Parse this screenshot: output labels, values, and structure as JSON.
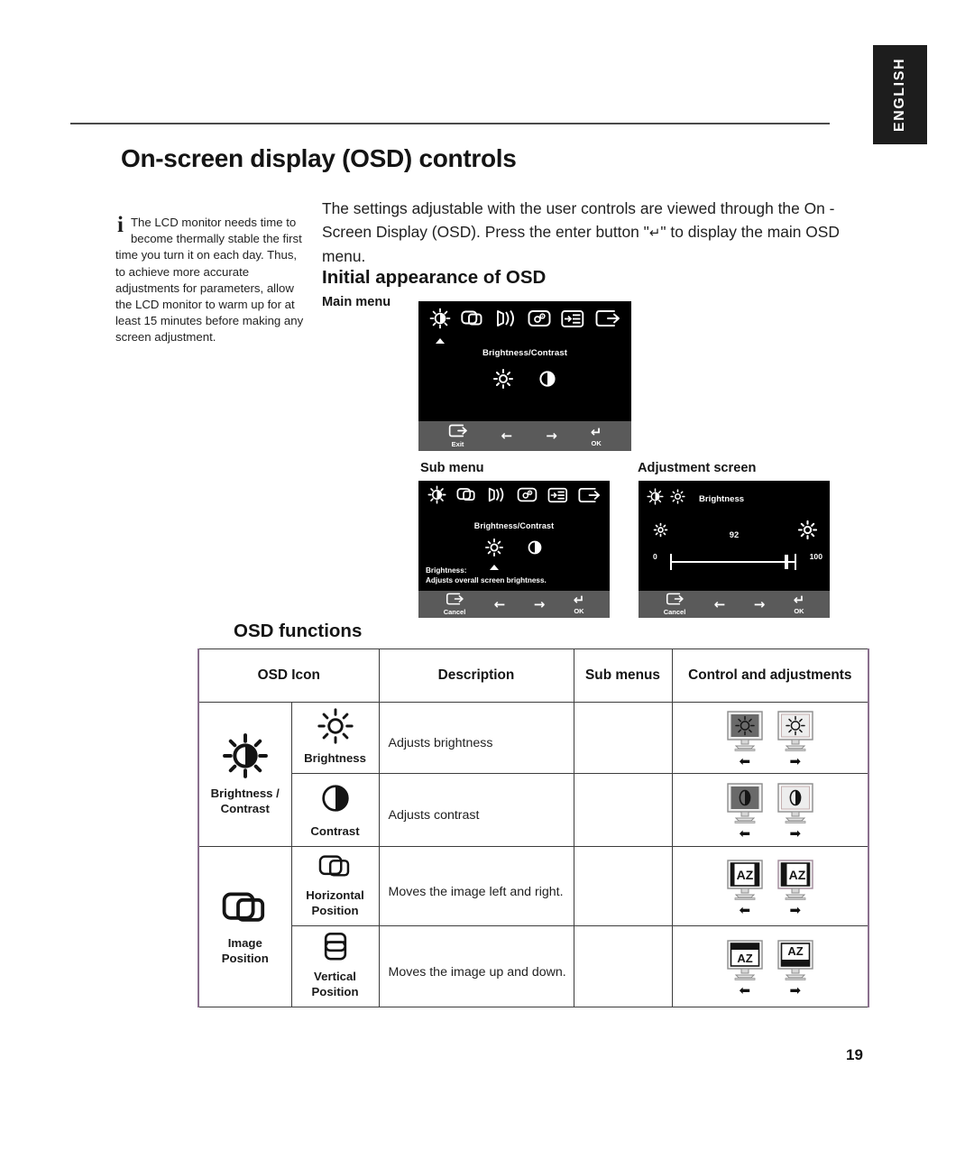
{
  "language_tab": {
    "label": "ENGLISH"
  },
  "page": {
    "number": "19"
  },
  "header": {
    "title": "On-screen display (OSD) controls"
  },
  "note": {
    "marker": "i",
    "text": "The LCD monitor needs time to become thermally stable the first time you turn it on each day. Thus, to achieve more accurate adjustments for parameters, allow the LCD monitor to warm up for  at least 15 minutes before making any screen adjustment."
  },
  "intro": {
    "part1": "The settings adjustable with the user controls are viewed through the On - Screen Display (OSD). Press the enter button \"",
    "enter_symbol": "↵",
    "part2": "\" to display the main OSD menu."
  },
  "sections": {
    "initial_appearance": "Initial appearance of OSD",
    "osd_functions": "OSD functions"
  },
  "osd_panels": {
    "main": {
      "caption": "Main menu",
      "title": "Brightness/Contrast",
      "icons": [
        "brightness-contrast-icon",
        "image-position-icon",
        "image-setup-icon",
        "image-properties-icon",
        "options-icon",
        "exit-icon"
      ],
      "sub_icons": [
        "brightness-sun-icon",
        "contrast-halfmoon-icon"
      ],
      "footer": [
        {
          "icon": "exit-icon",
          "label": "Exit"
        },
        {
          "icon": "left-arrow-icon",
          "label": ""
        },
        {
          "icon": "right-arrow-icon",
          "label": ""
        },
        {
          "icon": "enter-icon",
          "label": "OK"
        }
      ]
    },
    "sub": {
      "caption": "Sub menu",
      "title": "Brightness/Contrast",
      "desc_line1": "Brightness:",
      "desc_line2": "Adjusts overall screen brightness.",
      "footer": [
        {
          "icon": "exit-icon",
          "label": "Cancel"
        },
        {
          "icon": "left-arrow-icon",
          "label": ""
        },
        {
          "icon": "right-arrow-icon",
          "label": ""
        },
        {
          "icon": "enter-icon",
          "label": "OK"
        }
      ]
    },
    "adjustment": {
      "caption": "Adjustment screen",
      "title": "Brightness",
      "value": "92",
      "min": "0",
      "max": "100",
      "footer": [
        {
          "icon": "exit-icon",
          "label": "Cancel"
        },
        {
          "icon": "left-arrow-icon",
          "label": ""
        },
        {
          "icon": "right-arrow-icon",
          "label": ""
        },
        {
          "icon": "enter-icon",
          "label": "OK"
        }
      ]
    }
  },
  "table": {
    "headers": {
      "osd_icon": "OSD Icon",
      "description": "Description",
      "sub_menus": "Sub menus",
      "control": "Control and adjustments"
    },
    "groups": [
      {
        "category_label_line1": "Brightness /",
        "category_label_line2": "Contrast",
        "category_icon": "brightness-contrast-icon",
        "rows": [
          {
            "sub_label_line1": "Brightness",
            "sub_label_line2": "",
            "sub_icon": "brightness-sun-icon",
            "description": "Adjusts brightness",
            "sub_menus": "",
            "control_icon": "monitor-brightness-pair"
          },
          {
            "sub_label_line1": "Contrast",
            "sub_label_line2": "",
            "sub_icon": "contrast-halfmoon-icon",
            "description": "Adjusts contrast",
            "sub_menus": "",
            "control_icon": "monitor-contrast-pair"
          }
        ]
      },
      {
        "category_label_line1": "Image",
        "category_label_line2": "Position",
        "category_icon": "image-position-icon",
        "rows": [
          {
            "sub_label_line1": "Horizontal",
            "sub_label_line2": "Position",
            "sub_icon": "horizontal-position-icon",
            "description": "Moves the image left and right.",
            "sub_menus": "",
            "control_icon": "monitor-horizontal-pair"
          },
          {
            "sub_label_line1": "Vertical",
            "sub_label_line2": "Position",
            "sub_icon": "vertical-position-icon",
            "description": "Moves the image up and down.",
            "sub_menus": "",
            "control_icon": "monitor-vertical-pair"
          }
        ]
      }
    ]
  },
  "colors": {
    "table_outer_border": "#8a6f8e",
    "table_inner_border": "#3c3c3c",
    "osd_background": "#000000",
    "osd_footer": "#5a5a5a",
    "tab_background": "#1d1d1d"
  }
}
